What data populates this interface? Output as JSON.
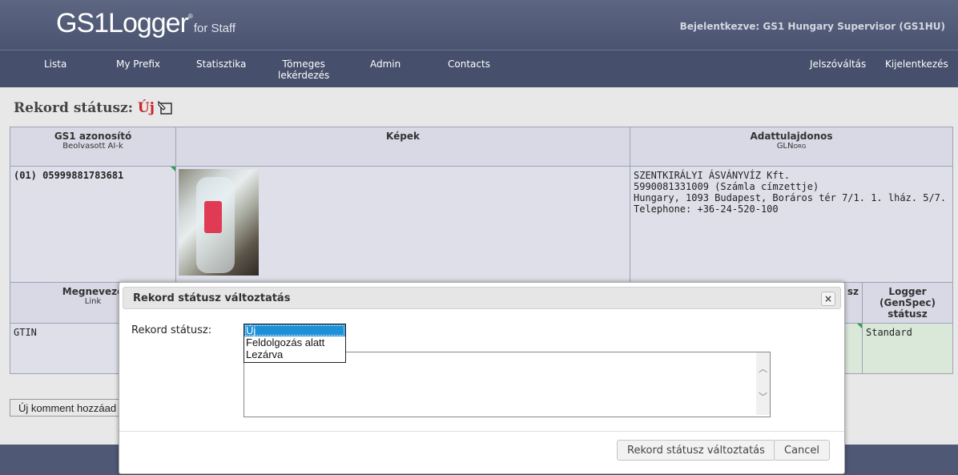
{
  "header": {
    "logo_main": "GS1Logger",
    "logo_reg": "®",
    "logo_sub": "for Staff",
    "logged_in": "Bejelentkezve: GS1 Hungary Supervisor (GS1HU)"
  },
  "nav": {
    "lista": "Lista",
    "my_prefix": "My Prefix",
    "statisztika": "Statisztika",
    "tomeges_1": "Tömeges",
    "tomeges_2": "lekérdezés",
    "admin": "Admin",
    "contacts": "Contacts",
    "jelszo": "Jelszóváltás",
    "kijelentkezes": "Kijelentkezés"
  },
  "record": {
    "title_prefix": "Rekord státusz:",
    "status": "Új"
  },
  "table": {
    "col1_header": "GS1 azonosító",
    "col1_sub": "Beolvasott AI-k",
    "col2_header": "Képek",
    "col3_header": "Adattulajdonos",
    "col3_sub_main": "GLN",
    "col3_sub_small": "ORG",
    "gs1_id": "(01) 05999881783681",
    "owner_name": "SZENTKIRÁLYI ÁSVÁNYVÍZ Kft.",
    "owner_gln": "5990081331009 (Számla címzettje)",
    "owner_address": "Hungary, 1093 Budapest, Boráros tér 7/1. 1. lház. 5/7.",
    "owner_phone": "Telephone: +36-24-520-100",
    "row2_col1_header": "Megnevezé",
    "row2_col1_sub": "Link",
    "row2_partial_header": "sz",
    "row2_logger_header": "Logger (GenSpec) státusz",
    "row2_col1_value": "GTIN",
    "row2_logger_value": "Standard"
  },
  "add_comment_label": "Új komment hozzáad",
  "dialog": {
    "title": "Rekord státusz változtatás",
    "close_glyph": "×",
    "field_label": "Rekord státusz:",
    "options": [
      "Új",
      "Feldolgozás alatt",
      "Lezárva"
    ],
    "selected_option": "Új",
    "comment_value": "",
    "submit_label": "Rekord státusz változtatás",
    "cancel_label": "Cancel"
  }
}
